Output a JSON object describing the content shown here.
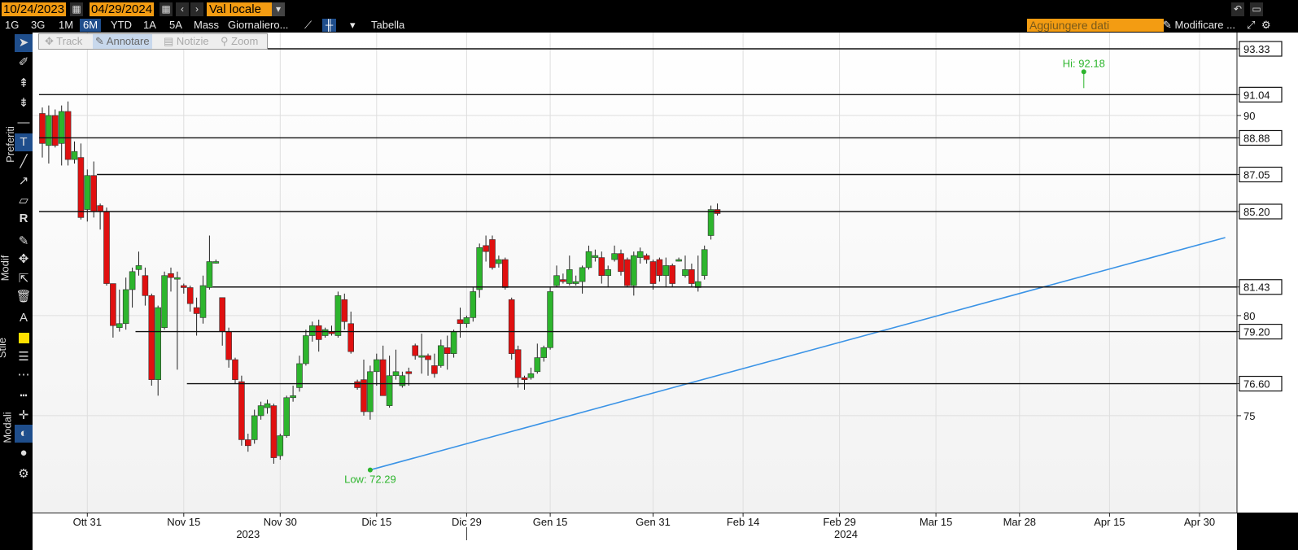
{
  "header": {
    "start_date": "10/24/2023",
    "end_date": "04/29/2024",
    "currency": "Val locale",
    "periods": [
      "1G",
      "3G",
      "1M",
      "6M",
      "YTD",
      "1A",
      "5A",
      "Mass"
    ],
    "active_period": "6M",
    "interval": "Giornaliero...",
    "table_label": "Tabella",
    "add_data_placeholder": "Aggiungere dati",
    "edit_label": "Modificare ..."
  },
  "modes": [
    "Track",
    "Annotare",
    "Notizie",
    "Zoom"
  ],
  "side_labels": [
    "Preferiti",
    "Modif",
    "Stile",
    "Modali"
  ],
  "colors": {
    "up": "#2db52d",
    "down": "#e01010",
    "trendline": "#3a93e6",
    "hilo": "#2db52d",
    "accent": "#f39c12"
  },
  "chart_data": {
    "type": "candlestick",
    "ylim": [
      70.5,
      94.2
    ],
    "xlim": [
      0,
      184
    ],
    "hi_label": "Hi: 92.18",
    "low_label": "Low: 72.29",
    "hi_point": {
      "x": 162,
      "y": 92.18
    },
    "low_point": {
      "x": 51,
      "y": 72.29
    },
    "right_ticks": [
      {
        "label": "93.33",
        "value": 93.33,
        "boxed": true
      },
      {
        "label": "91.04",
        "value": 91.04,
        "boxed": true
      },
      {
        "label": "90",
        "value": 90,
        "boxed": false
      },
      {
        "label": "88.88",
        "value": 88.88,
        "boxed": true
      },
      {
        "label": "87.05",
        "value": 87.05,
        "boxed": true
      },
      {
        "label": "85.20",
        "value": 85.2,
        "boxed": true
      },
      {
        "label": "81.43",
        "value": 81.43,
        "boxed": true
      },
      {
        "label": "80",
        "value": 80,
        "boxed": false
      },
      {
        "label": "79.20",
        "value": 79.2,
        "boxed": true
      },
      {
        "label": "76.60",
        "value": 76.6,
        "boxed": true
      },
      {
        "label": "75",
        "value": 75,
        "boxed": false
      }
    ],
    "hlines": [
      {
        "value": 93.33,
        "x_start": 1
      },
      {
        "value": 91.04,
        "x_start": 0
      },
      {
        "value": 88.88,
        "x_start": 0
      },
      {
        "value": 87.05,
        "x_start": 9
      },
      {
        "value": 85.2,
        "x_start": 0
      },
      {
        "value": 81.43,
        "x_start": 27
      },
      {
        "value": 79.2,
        "x_start": 15
      },
      {
        "value": 76.6,
        "x_start": 23
      }
    ],
    "trendline": {
      "from": [
        51,
        72.29
      ],
      "to": [
        184,
        83.9
      ]
    },
    "x_ticks": [
      {
        "label": "Ott 31",
        "x": 7
      },
      {
        "label": "Nov 15",
        "x": 22
      },
      {
        "label": "Nov 30",
        "x": 37
      },
      {
        "label": "Dic 15",
        "x": 52
      },
      {
        "label": "Dic 29",
        "x": 66
      },
      {
        "label": "Gen 15",
        "x": 79
      },
      {
        "label": "Gen 31",
        "x": 95
      },
      {
        "label": "Feb 14",
        "x": 109
      },
      {
        "label": "Feb 29",
        "x": 124
      },
      {
        "label": "Mar 15",
        "x": 139
      },
      {
        "label": "Mar 28",
        "x": 152
      },
      {
        "label": "Apr 15",
        "x": 166
      },
      {
        "label": "Apr 30",
        "x": 180
      }
    ],
    "years": [
      {
        "label": "2023",
        "x": 32
      },
      {
        "label": "2024",
        "x": 125
      }
    ],
    "candles": [
      [
        0,
        90.1,
        90.4,
        87.9,
        88.6
      ],
      [
        1,
        88.5,
        90.5,
        87.6,
        90.0
      ],
      [
        2,
        90.0,
        90.3,
        88.4,
        88.5
      ],
      [
        3,
        88.6,
        90.5,
        87.5,
        90.2
      ],
      [
        4,
        90.2,
        90.7,
        87.5,
        87.8
      ],
      [
        5,
        87.8,
        88.7,
        87.6,
        88.2
      ],
      [
        6,
        87.9,
        88.6,
        84.8,
        84.9
      ],
      [
        7,
        85.3,
        87.3,
        84.7,
        87.0
      ],
      [
        8,
        87.0,
        87.7,
        84.9,
        85.2
      ],
      [
        9,
        85.5,
        85.6,
        84.3,
        85.2
      ],
      [
        10,
        85.2,
        85.4,
        81.5,
        81.6
      ],
      [
        11,
        81.6,
        81.6,
        78.9,
        79.5
      ],
      [
        12,
        79.4,
        81.3,
        79.2,
        79.6
      ],
      [
        13,
        79.6,
        81.9,
        79.3,
        81.3
      ],
      [
        14,
        81.3,
        82.4,
        80.4,
        82.2
      ],
      [
        15,
        82.3,
        83.2,
        82.0,
        82.5
      ],
      [
        16,
        82.0,
        82.4,
        80.5,
        81.0
      ],
      [
        17,
        81.0,
        81.1,
        76.5,
        76.8
      ],
      [
        18,
        76.8,
        80.5,
        76.0,
        80.4
      ],
      [
        19,
        79.4,
        82.2,
        79.3,
        82.0
      ],
      [
        20,
        82.1,
        82.4,
        81.2,
        81.9
      ],
      [
        21,
        81.9,
        82.2,
        77.3,
        81.9
      ],
      [
        22,
        81.5,
        81.6,
        81.1,
        81.4
      ],
      [
        23,
        81.4,
        81.5,
        80.2,
        80.6
      ],
      [
        24,
        80.4,
        80.9,
        79.0,
        80.1
      ],
      [
        25,
        79.9,
        82.0,
        79.6,
        81.5
      ],
      [
        26,
        81.4,
        84.0,
        81.3,
        82.7
      ],
      [
        27,
        82.7,
        82.8,
        82.6,
        82.7
      ],
      [
        28,
        80.9,
        80.9,
        78.5,
        79.2
      ],
      [
        29,
        79.2,
        79.4,
        77.4,
        77.8
      ],
      [
        30,
        77.8,
        77.9,
        76.6,
        76.8
      ],
      [
        31,
        76.7,
        77.0,
        73.5,
        73.8
      ],
      [
        32,
        73.8,
        74.1,
        73.2,
        73.5
      ],
      [
        33,
        73.8,
        75.3,
        73.6,
        75.0
      ],
      [
        34,
        75.0,
        75.7,
        74.8,
        75.5
      ],
      [
        35,
        75.4,
        75.8,
        75.1,
        75.6
      ],
      [
        36,
        75.5,
        75.6,
        72.6,
        72.9
      ],
      [
        37,
        73.0,
        74.1,
        72.8,
        74.0
      ],
      [
        38,
        74.0,
        76.0,
        73.9,
        75.9
      ],
      [
        39,
        75.9,
        76.5,
        75.7,
        76.0
      ],
      [
        40,
        76.4,
        78.0,
        76.2,
        77.6
      ],
      [
        41,
        77.6,
        79.3,
        77.5,
        79.0
      ],
      [
        42,
        79.0,
        79.7,
        78.7,
        79.5
      ],
      [
        43,
        79.5,
        79.8,
        78.2,
        78.8
      ],
      [
        44,
        79.0,
        79.4,
        78.9,
        79.3
      ],
      [
        45,
        79.2,
        79.5,
        79.0,
        79.1
      ],
      [
        46,
        79.0,
        81.2,
        78.9,
        81.0
      ],
      [
        47,
        80.8,
        81.1,
        79.3,
        79.7
      ],
      [
        48,
        79.6,
        80.2,
        78.1,
        78.2
      ],
      [
        49,
        76.7,
        76.8,
        76.3,
        76.4
      ],
      [
        50,
        76.8,
        77.8,
        75.0,
        75.2
      ],
      [
        51,
        75.2,
        77.5,
        74.8,
        77.2
      ],
      [
        52,
        77.2,
        78.1,
        76.5,
        77.8
      ],
      [
        53,
        77.8,
        78.5,
        76.0,
        76.0
      ],
      [
        54,
        75.5,
        78.0,
        75.4,
        77.0
      ],
      [
        55,
        77.0,
        78.3,
        76.8,
        77.2
      ],
      [
        56,
        76.5,
        77.2,
        76.4,
        77.0
      ],
      [
        57,
        77.2,
        77.4,
        76.5,
        77.1
      ],
      [
        58,
        78.5,
        78.6,
        77.8,
        78.0
      ],
      [
        59,
        78.0,
        79.1,
        77.1,
        78.0
      ],
      [
        60,
        78.0,
        78.1,
        77.0,
        77.8
      ],
      [
        61,
        77.5,
        78.1,
        76.9,
        77.1
      ],
      [
        62,
        77.5,
        78.8,
        77.4,
        78.5
      ],
      [
        63,
        78.4,
        79.0,
        77.3,
        78.1
      ],
      [
        64,
        78.1,
        79.3,
        77.9,
        79.2
      ],
      [
        65,
        79.8,
        80.4,
        78.9,
        79.6
      ],
      [
        66,
        79.6,
        80.0,
        79.4,
        79.9
      ],
      [
        67,
        79.9,
        81.4,
        79.7,
        81.2
      ],
      [
        68,
        81.3,
        83.6,
        80.9,
        83.4
      ],
      [
        69,
        83.5,
        84.0,
        82.7,
        83.2
      ],
      [
        70,
        83.8,
        84.0,
        82.3,
        82.4
      ],
      [
        71,
        82.6,
        83.0,
        82.4,
        82.8
      ],
      [
        72,
        82.8,
        82.9,
        81.3,
        81.4
      ],
      [
        73,
        80.8,
        80.9,
        77.8,
        78.1
      ],
      [
        74,
        78.3,
        78.5,
        76.4,
        76.9
      ],
      [
        75,
        76.9,
        77.0,
        76.3,
        76.8
      ],
      [
        76,
        76.9,
        77.4,
        76.8,
        77.1
      ],
      [
        77,
        77.2,
        78.6,
        77.1,
        77.9
      ],
      [
        78,
        77.9,
        78.5,
        77.7,
        78.4
      ],
      [
        79,
        78.4,
        81.4,
        78.3,
        81.2
      ],
      [
        80,
        81.5,
        82.5,
        81.4,
        82.0
      ],
      [
        81,
        81.8,
        82.1,
        81.6,
        81.7
      ],
      [
        82,
        81.6,
        83.0,
        81.5,
        82.3
      ],
      [
        83,
        81.6,
        82.0,
        81.5,
        81.7
      ],
      [
        84,
        81.7,
        82.5,
        81.1,
        82.4
      ],
      [
        85,
        82.4,
        83.5,
        82.3,
        83.2
      ],
      [
        86,
        82.9,
        83.3,
        82.7,
        83.0
      ],
      [
        87,
        82.9,
        83.2,
        81.6,
        82.0
      ],
      [
        88,
        82.0,
        82.5,
        81.4,
        82.3
      ],
      [
        89,
        82.8,
        83.5,
        82.7,
        83.1
      ],
      [
        90,
        83.1,
        83.3,
        82.0,
        82.2
      ],
      [
        91,
        82.8,
        82.9,
        81.4,
        81.5
      ],
      [
        92,
        81.5,
        83.2,
        81.0,
        83.0
      ],
      [
        93,
        82.9,
        83.4,
        82.6,
        83.2
      ],
      [
        94,
        83.0,
        83.1,
        82.6,
        82.8
      ],
      [
        95,
        82.7,
        82.8,
        81.3,
        81.6
      ],
      [
        96,
        82.8,
        82.9,
        81.7,
        82.0
      ],
      [
        97,
        82.0,
        82.9,
        81.4,
        82.5
      ],
      [
        98,
        82.5,
        82.6,
        81.4,
        81.6
      ],
      [
        99,
        82.8,
        82.9,
        82.7,
        82.8
      ],
      [
        100,
        82.0,
        83.0,
        81.9,
        82.3
      ],
      [
        101,
        82.3,
        82.6,
        81.4,
        81.6
      ],
      [
        102,
        81.4,
        83.0,
        81.2,
        81.7
      ],
      [
        103,
        82.0,
        83.5,
        81.8,
        83.3
      ],
      [
        104,
        84.0,
        85.5,
        83.8,
        85.3
      ],
      [
        105,
        85.3,
        85.6,
        85.0,
        85.1
      ]
    ]
  }
}
